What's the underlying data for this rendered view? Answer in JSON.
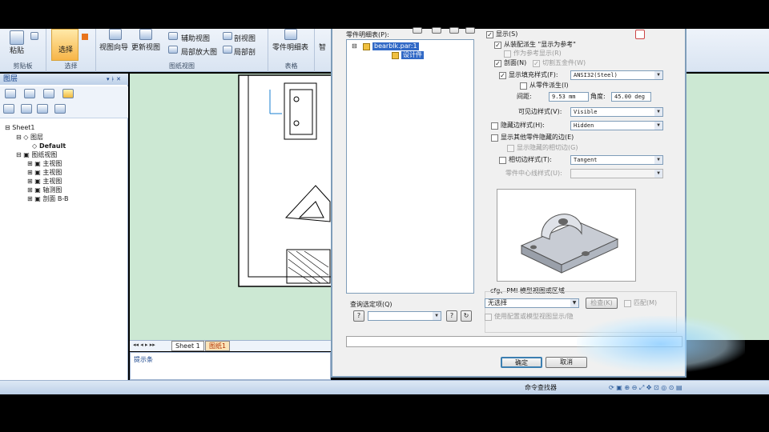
{
  "ribbon": {
    "paste": "粘贴",
    "clipboard": "剪贴板",
    "select": "选择",
    "select_group": "选择",
    "view_wizard": "视图向导",
    "update_views": "更新视图",
    "aux_view": "辅助视图",
    "section_view": "剖视图",
    "detail_view": "局部放大图",
    "partial_section": "局部剖",
    "drawing_views": "图纸视图",
    "parts_list": "零件明细表",
    "table_group": "表格",
    "smart": "智"
  },
  "layers_panel": {
    "title": "图层",
    "tree": [
      {
        "label": "Sheet1",
        "indent": 0
      },
      {
        "label": "图层",
        "indent": 1
      },
      {
        "label": "Default",
        "indent": 2
      },
      {
        "label": "图纸视图",
        "indent": 1
      },
      {
        "label": "主视图",
        "indent": 2
      },
      {
        "label": "主视图",
        "indent": 2
      },
      {
        "label": "主视图",
        "indent": 2
      },
      {
        "label": "轴测图",
        "indent": 2
      },
      {
        "label": "剖面 B-B",
        "indent": 2
      }
    ]
  },
  "sheet_tabs": {
    "sheet1": "Sheet 1",
    "sheet2": "图纸1"
  },
  "status": {
    "prompt": "提示条",
    "command_finder": "命令查找器"
  },
  "dialog": {
    "parts_label": "零件明细表(P):",
    "tree": {
      "root": "bearblk.par:1",
      "child": "设计件"
    },
    "query_label": "查询选定项(Q)",
    "options": {
      "show": "显示(S)",
      "derive_as_ref": "从装配派生 \"显示为参考\"",
      "as_ref": "作为参考显示(R)",
      "section": "剖面(N)",
      "cut_hardware": "切割五金件(W)",
      "show_fill": "显示填充样式(F):",
      "fill_value": "ANSI32(Steel)",
      "derive_from_part": "从零件派生(I)",
      "spacing_label": "间距:",
      "spacing_value": "9.53 mm",
      "angle_label": "角度:",
      "angle_value": "45.00 deg",
      "visible_edge": "可见边样式(V):",
      "visible_value": "Visible",
      "hidden_edge": "隐藏边样式(H):",
      "hidden_value": "Hidden",
      "show_other_hidden": "显示其他零件隐藏的边(E)",
      "show_hidden_tangent": "显示隐藏的相切边(G)",
      "tangent_edge": "相切边样式(T):",
      "tangent_value": "Tangent",
      "centerline": "零件中心线样式(U):"
    },
    "cfg_group": "cfg、PMI 模型视图或区域",
    "no_select": "无选择",
    "check_btn": "检查(K)",
    "match": "匹配(M)",
    "use_config": "使用配置或模型视图显示/隐",
    "ok": "确定",
    "cancel": "取消"
  }
}
